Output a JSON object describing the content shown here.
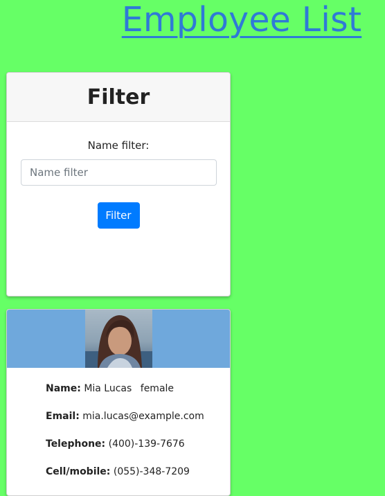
{
  "page": {
    "title": "Employee List"
  },
  "filter": {
    "heading": "Filter",
    "label": "Name filter:",
    "placeholder": "Name filter",
    "value": "",
    "button_label": "Filter"
  },
  "employees": [
    {
      "photo": "portrait-photo",
      "name_label": "Name:",
      "name": "Mia Lucas",
      "gender": "female",
      "email_label": "Email:",
      "email": "mia.lucas@example.com",
      "telephone_label": "Telephone:",
      "telephone": "(400)-139-7676",
      "cell_label": "Cell/mobile:",
      "cell": "(055)-348-7209"
    }
  ],
  "colors": {
    "background": "#66ff66",
    "title_link": "#2f7ad6",
    "primary_button": "#007bff",
    "photo_banner": "#6fa8dc"
  }
}
